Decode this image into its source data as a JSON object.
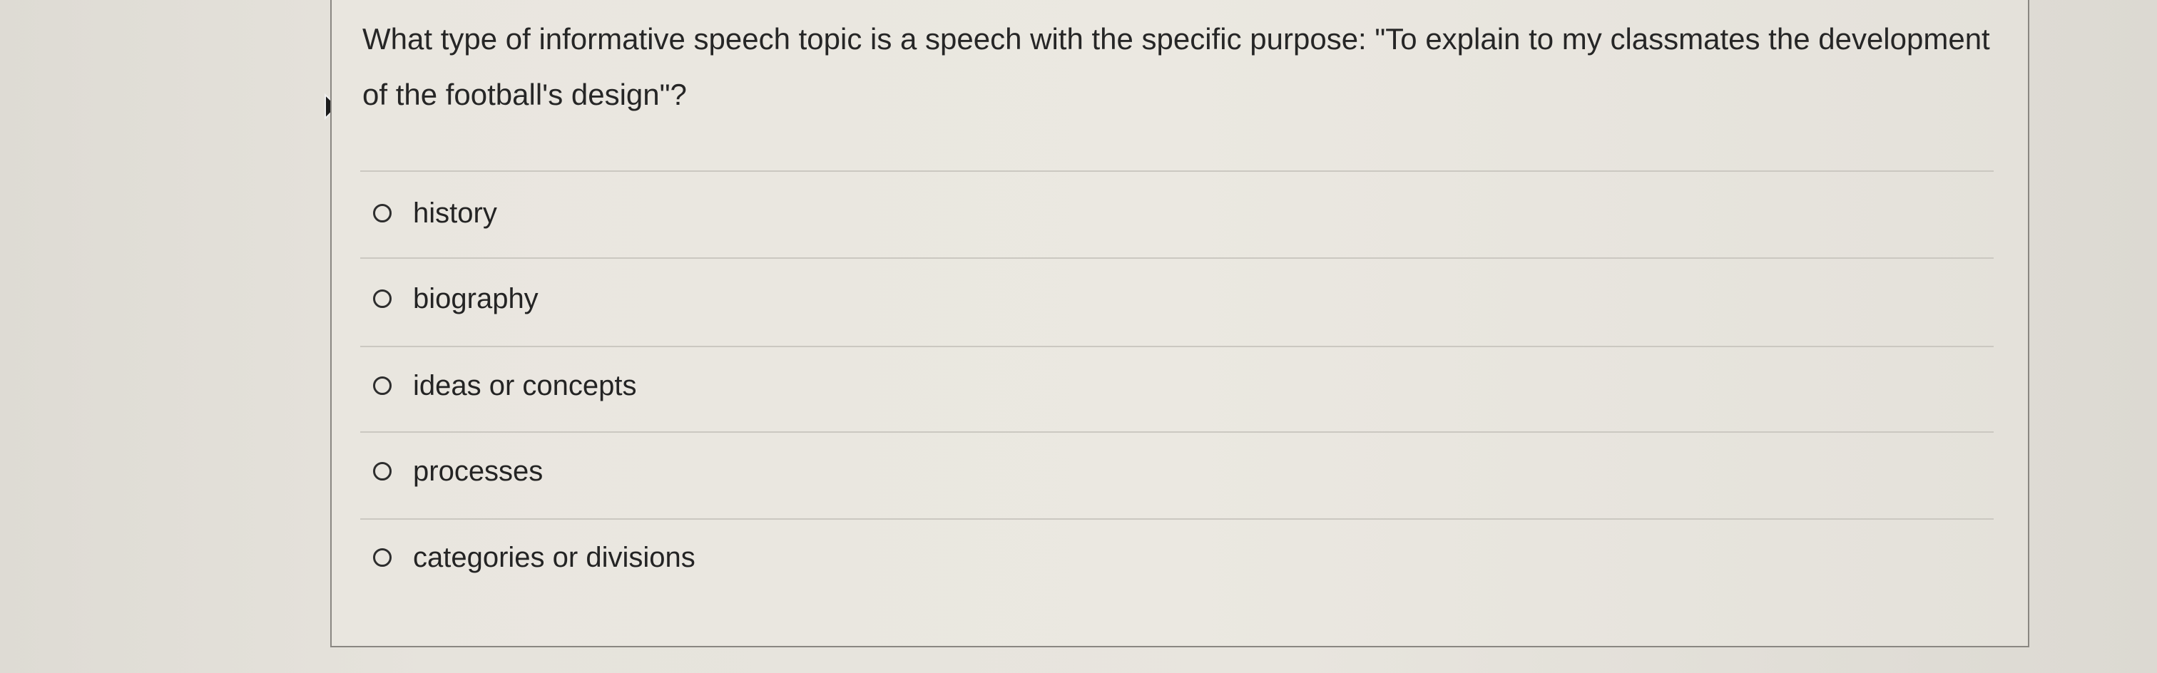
{
  "quiz": {
    "question": "What type of informative speech topic is a speech with the specific purpose: \"To explain to my classmates the development of the football's design\"?",
    "options": [
      {
        "label": "history",
        "selected": false
      },
      {
        "label": "biography",
        "selected": false
      },
      {
        "label": "ideas or concepts",
        "selected": false
      },
      {
        "label": "processes",
        "selected": false
      },
      {
        "label": "categories or divisions",
        "selected": false
      }
    ]
  },
  "cursor": {
    "icon": "mouse-pointer-icon"
  }
}
